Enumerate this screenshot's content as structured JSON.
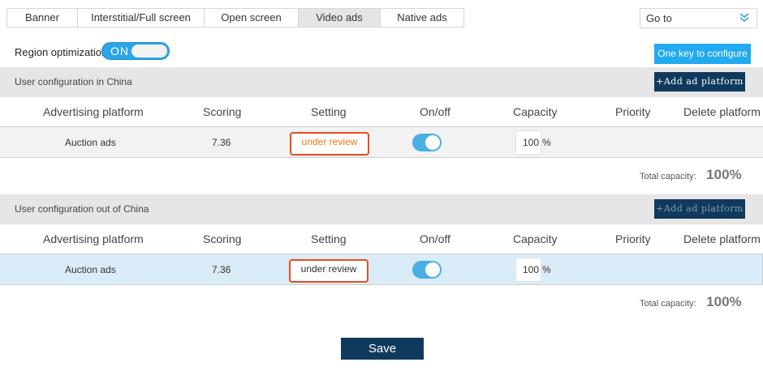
{
  "tabs": [
    {
      "label": "Banner",
      "active": false
    },
    {
      "label": "Interstitial/Full screen",
      "active": false
    },
    {
      "label": "Open screen",
      "active": false
    },
    {
      "label": "Video ads",
      "active": true
    },
    {
      "label": "Native ads",
      "active": false
    }
  ],
  "goto": {
    "label": "Go to",
    "icon": "double-chevron-down-icon"
  },
  "region": {
    "label": "Region optimization",
    "toggle_text": "ON",
    "state": "on"
  },
  "one_key_label": "One key to configure",
  "columns": [
    "Advertising platform",
    "Scoring",
    "Setting",
    "On/off",
    "Capacity",
    "Priority",
    "Delete platform"
  ],
  "sections": [
    {
      "title": "User configuration in China",
      "add_label": "+Add ad platform",
      "row": {
        "platform": "Auction ads",
        "score": "7.36",
        "setting": "under review",
        "onoff": "on",
        "capacity": "100",
        "unit": "%",
        "priority": "",
        "delete": ""
      },
      "total_label": "Total capacity:",
      "total_value": "100%"
    },
    {
      "title": "User configuration out of China",
      "add_label": "+Add ad platform",
      "row": {
        "platform": "Auction ads",
        "score": "7.36",
        "setting": "under review",
        "onoff": "on",
        "capacity": "100",
        "unit": "%",
        "priority": "",
        "delete": ""
      },
      "total_label": "Total capacity:",
      "total_value": "100%"
    }
  ],
  "save_label": "Save",
  "colors": {
    "accent": "#22aaee",
    "navy": "#0f3a5d",
    "review_border": "#e84c1e",
    "review_text_orange": "#e8791a",
    "row_highlight": "#daecf7"
  }
}
